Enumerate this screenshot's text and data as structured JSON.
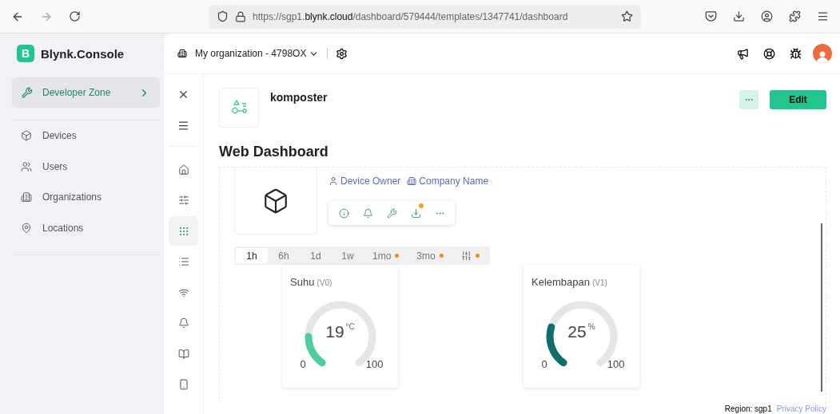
{
  "browser": {
    "url": "https://sgp1.**blynk.cloud**/dashboard/579444/templates/1347741/dashboard"
  },
  "header": {
    "logo_letter": "B",
    "brand": "Blynk.Console",
    "organization": "My organization - 4798OX"
  },
  "sidebar": {
    "zone": {
      "label": "Developer Zone",
      "selected": true
    },
    "items": [
      {
        "label": "Devices"
      },
      {
        "label": "Users"
      },
      {
        "label": "Organizations"
      },
      {
        "label": "Locations"
      }
    ]
  },
  "rail": [
    {
      "selected": false
    },
    {
      "selected": false
    },
    {
      "selected": true
    },
    {
      "selected": false
    },
    {
      "selected": false
    },
    {
      "selected": false
    },
    {
      "selected": false
    },
    {
      "selected": false
    }
  ],
  "template": {
    "name": "komposter",
    "edit_label": "Edit"
  },
  "page_title": "Web Dashboard",
  "device": {
    "owner": "Device Owner",
    "company": "Company Name",
    "actions": [
      {
        "dot": false
      },
      {
        "dot": false
      },
      {
        "dot": false
      },
      {
        "dot": true
      },
      {
        "dot": false
      }
    ]
  },
  "time_tabs": [
    {
      "kind": "text",
      "label": "1h",
      "selected": true,
      "dot": false
    },
    {
      "kind": "text",
      "label": "6h",
      "selected": false,
      "dot": false
    },
    {
      "kind": "text",
      "label": "1d",
      "selected": false,
      "dot": false
    },
    {
      "kind": "text",
      "label": "1w",
      "selected": false,
      "dot": false
    },
    {
      "kind": "text",
      "label": "1mo",
      "selected": false,
      "dot": true
    },
    {
      "kind": "text",
      "label": "3mo",
      "selected": false,
      "dot": true
    },
    {
      "kind": "icon",
      "selected": false,
      "dot": true
    }
  ],
  "widgets": [
    {
      "title": "Suhu",
      "pin": "(V0)",
      "value": "19",
      "unit": "°C",
      "min": "0",
      "max": "100",
      "color": "#4ccf9c"
    },
    {
      "title": "Kelembapan",
      "pin": "(V1)",
      "value": "25",
      "unit": "%",
      "min": "0",
      "max": "100",
      "color": "#0f6e6c"
    }
  ],
  "footer": {
    "region": "Region: sgp1",
    "privacy": "Privacy Policy"
  }
}
